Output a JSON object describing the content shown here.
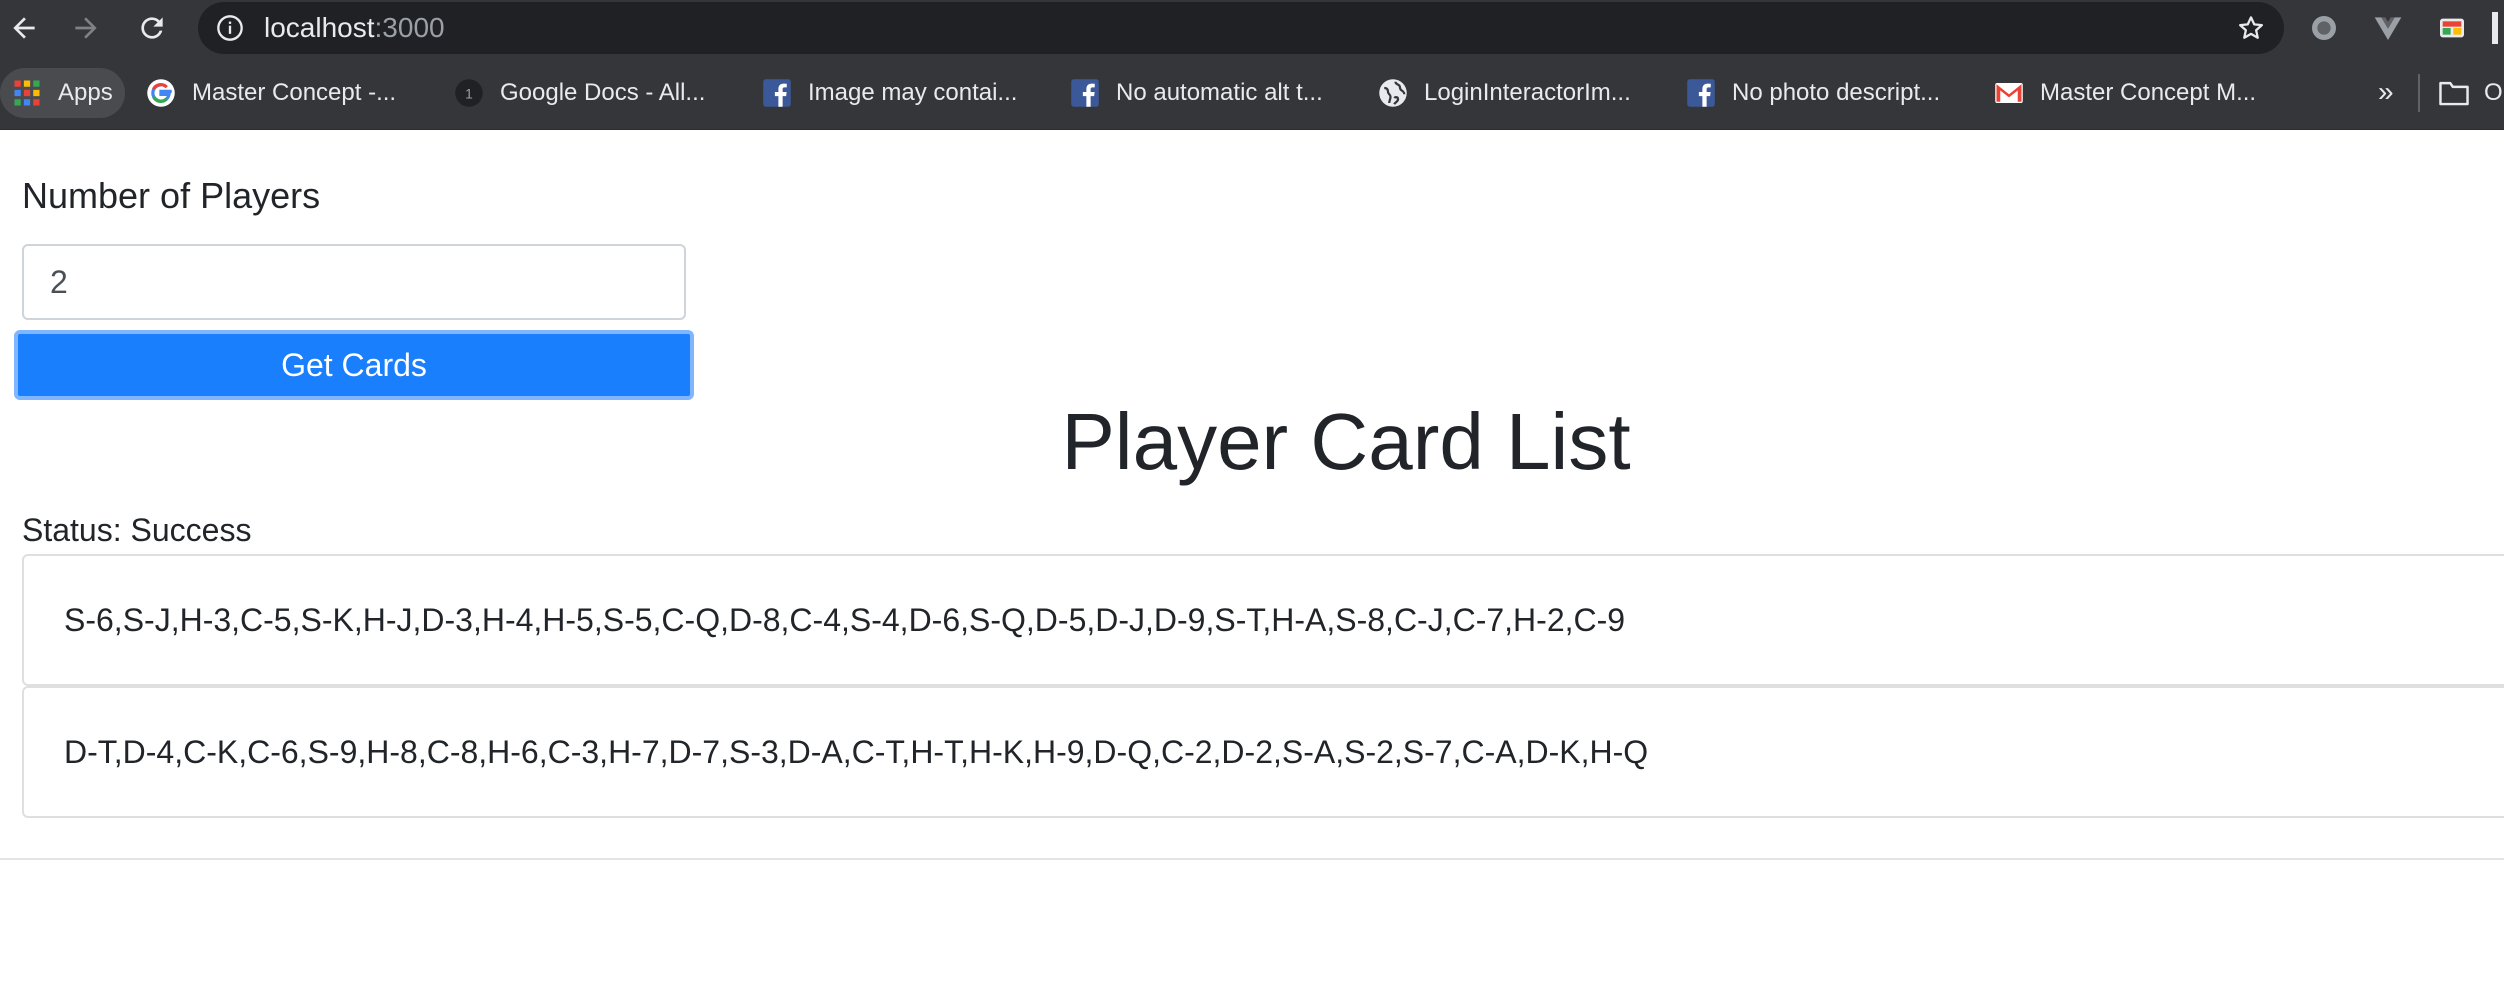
{
  "browser": {
    "url_host": "localhost",
    "url_port": ":3000",
    "bookmarks": [
      {
        "label": "Apps",
        "icon": "apps-grid-icon"
      },
      {
        "label": "Master Concept -...",
        "icon": "google-icon"
      },
      {
        "label": "Google Docs - All...",
        "icon": "dark-circle-icon"
      },
      {
        "label": "Image may contai...",
        "icon": "facebook-icon"
      },
      {
        "label": "No automatic alt t...",
        "icon": "facebook-icon"
      },
      {
        "label": "LoginInteractorIm...",
        "icon": "globe-icon"
      },
      {
        "label": "No photo descript...",
        "icon": "facebook-icon"
      },
      {
        "label": "Master Concept M...",
        "icon": "gmail-icon"
      }
    ],
    "more_label": "»",
    "other_bookmarks_label": "O"
  },
  "form": {
    "label": "Number of Players",
    "players_value": "2",
    "button_label": "Get Cards"
  },
  "results": {
    "title": "Player Card List",
    "status": "Status: Success",
    "players": [
      "S-6,S-J,H-3,C-5,S-K,H-J,D-3,H-4,H-5,S-5,C-Q,D-8,C-4,S-4,D-6,S-Q,D-5,D-J,D-9,S-T,H-A,S-8,C-J,C-7,H-2,C-9",
      "D-T,D-4,C-K,C-6,S-9,H-8,C-8,H-6,C-3,H-7,D-7,S-3,D-A,C-T,H-T,H-K,H-9,D-Q,C-2,D-2,S-A,S-2,S-7,C-A,D-K,H-Q"
    ]
  },
  "colors": {
    "chrome_bg": "#35363a",
    "omnibox_bg": "#202124",
    "button_primary": "#1a7ffc",
    "text_dark": "#212529"
  }
}
